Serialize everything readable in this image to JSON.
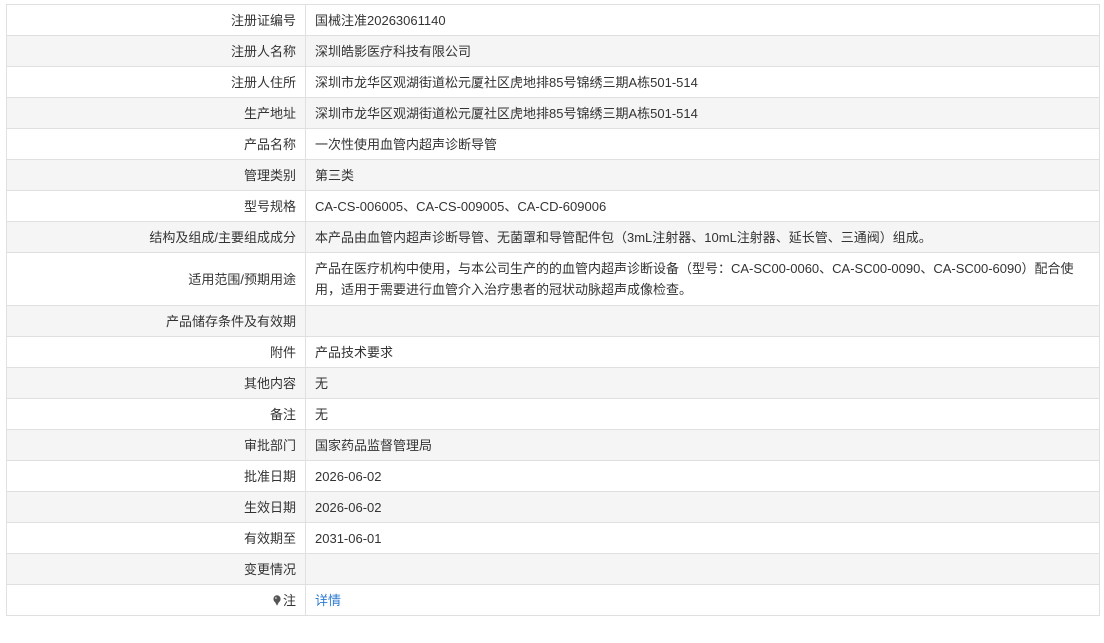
{
  "rows": [
    {
      "label": "注册证编号",
      "value": "国械注准20263061140"
    },
    {
      "label": "注册人名称",
      "value": "深圳皓影医疗科技有限公司"
    },
    {
      "label": "注册人住所",
      "value": "深圳市龙华区观湖街道松元厦社区虎地排85号锦绣三期A栋501-514"
    },
    {
      "label": "生产地址",
      "value": "深圳市龙华区观湖街道松元厦社区虎地排85号锦绣三期A栋501-514"
    },
    {
      "label": "产品名称",
      "value": "一次性使用血管内超声诊断导管"
    },
    {
      "label": "管理类别",
      "value": "第三类"
    },
    {
      "label": "型号规格",
      "value": "CA-CS-006005、CA-CS-009005、CA-CD-609006"
    },
    {
      "label": "结构及组成/主要组成成分",
      "value": "本产品由血管内超声诊断导管、无菌罩和导管配件包（3mL注射器、10mL注射器、延长管、三通阀）组成。"
    },
    {
      "label": "适用范围/预期用途",
      "value": "产品在医疗机构中使用，与本公司生产的的血管内超声诊断设备（型号：CA-SC00-0060、CA-SC00-0090、CA-SC00-6090）配合使用，适用于需要进行血管介入治疗患者的冠状动脉超声成像检查。"
    },
    {
      "label": "产品储存条件及有效期",
      "value": ""
    },
    {
      "label": "附件",
      "value": "产品技术要求"
    },
    {
      "label": "其他内容",
      "value": "无"
    },
    {
      "label": "备注",
      "value": "无"
    },
    {
      "label": "审批部门",
      "value": "国家药品监督管理局"
    },
    {
      "label": "批准日期",
      "value": "2026-06-02"
    },
    {
      "label": "生效日期",
      "value": "2026-06-02"
    },
    {
      "label": "有效期至",
      "value": "2031-06-01"
    },
    {
      "label": "变更情况",
      "value": ""
    }
  ],
  "note": {
    "icon": "pin-icon",
    "label": "注",
    "link_text": "详情",
    "link_color": "#2d7bd1"
  }
}
